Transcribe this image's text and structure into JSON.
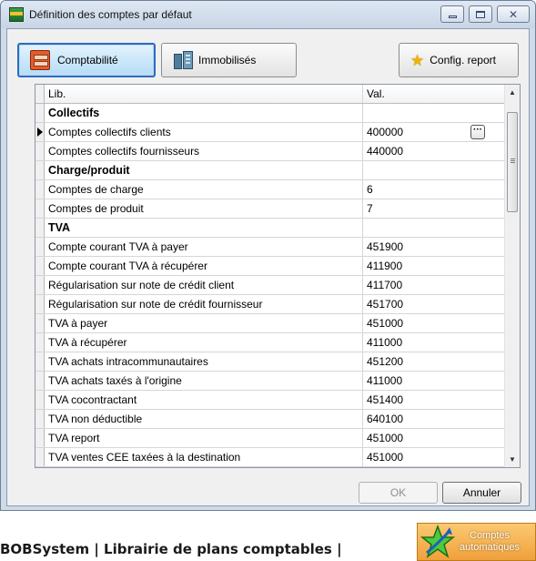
{
  "window": {
    "title": "Définition des comptes par défaut",
    "icon": "app-grid-icon",
    "controls": {
      "minimize": "minimize-icon",
      "maximize": "maximize-icon",
      "close": "✕"
    }
  },
  "toolbar": {
    "comptabilite_label": "Comptabilité",
    "immobilises_label": "Immobilisés",
    "config_label": "Config. report"
  },
  "grid": {
    "columns": [
      "Lib.",
      "Val."
    ],
    "rows": [
      {
        "type": "group",
        "lib": "Collectifs",
        "val": ""
      },
      {
        "type": "item",
        "lib": "Comptes collectifs clients",
        "val": "400000",
        "current": true
      },
      {
        "type": "item",
        "lib": "Comptes collectifs fournisseurs",
        "val": "440000"
      },
      {
        "type": "group",
        "lib": "Charge/produit",
        "val": ""
      },
      {
        "type": "item",
        "lib": "Comptes de charge",
        "val": "6"
      },
      {
        "type": "item",
        "lib": "Comptes de produit",
        "val": "7"
      },
      {
        "type": "group",
        "lib": "TVA",
        "val": ""
      },
      {
        "type": "item",
        "lib": "Compte courant TVA à payer",
        "val": "451900"
      },
      {
        "type": "item",
        "lib": "Compte courant TVA à récupérer",
        "val": "411900"
      },
      {
        "type": "item",
        "lib": "Régularisation sur note de crédit client",
        "val": "411700"
      },
      {
        "type": "item",
        "lib": "Régularisation sur note de crédit fournisseur",
        "val": "451700"
      },
      {
        "type": "item",
        "lib": "TVA à payer",
        "val": "451000"
      },
      {
        "type": "item",
        "lib": "TVA à récupérer",
        "val": "411000"
      },
      {
        "type": "item",
        "lib": "TVA achats intracommunautaires",
        "val": "451200"
      },
      {
        "type": "item",
        "lib": "TVA achats taxés à l'origine",
        "val": "411000"
      },
      {
        "type": "item",
        "lib": "TVA cocontractant",
        "val": "451400"
      },
      {
        "type": "item",
        "lib": "TVA non déductible",
        "val": "640100"
      },
      {
        "type": "item",
        "lib": "TVA report",
        "val": "451000"
      },
      {
        "type": "item",
        "lib": "TVA ventes CEE taxées à la destination",
        "val": "451000"
      }
    ],
    "ellipsis": "···"
  },
  "buttons": {
    "ok": "OK",
    "cancel": "Annuler"
  },
  "footer": {
    "text": "BOBSystem | Librairie de plans comptables |",
    "auto_line1": "Comptes",
    "auto_line2": "automatiques"
  },
  "colors": {
    "accent": "#2c6cbf",
    "auto_button": "#f0a03c"
  }
}
